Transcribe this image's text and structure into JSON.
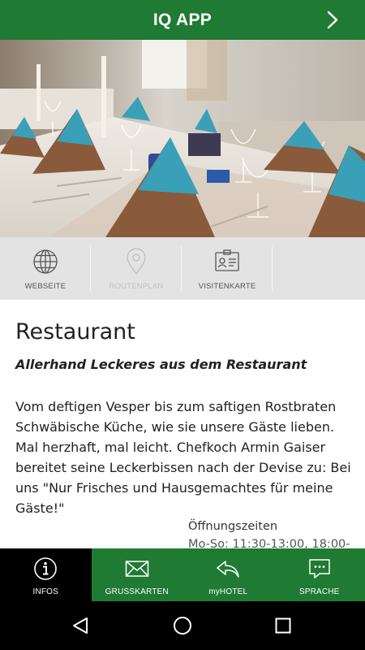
{
  "header": {
    "title": "IQ APP",
    "next_icon": "chevron-right-icon"
  },
  "actions": [
    {
      "label": "WEBSEITE",
      "icon": "globe-icon",
      "enabled": true
    },
    {
      "label": "ROUTENPLAN",
      "icon": "map-pin-icon",
      "enabled": false
    },
    {
      "label": "VISITENKARTE",
      "icon": "contact-card-icon",
      "enabled": true
    }
  ],
  "content": {
    "title": "Restaurant",
    "subtitle": "Allerhand Leckeres aus dem Restaurant",
    "body": "Vom deftigen Vesper bis zum saftigen Rostbraten Schwäbische Küche, wie sie unsere Gäste lieben. Mal herzhaft, mal leicht. Chefkoch Armin Gaiser bereitet seine Leckerbissen nach der Devise zu: Bei uns \"Nur Frisches und Hausgemachtes für meine Gäste!\"",
    "hours_title": "Öffnungszeiten",
    "hours_line": "Mo-So: 11:30-13:00, 18:00-"
  },
  "bottom_nav": [
    {
      "label": "INFOS",
      "icon": "info-icon",
      "active": true
    },
    {
      "label": "GRUSSKARTEN",
      "icon": "envelope-icon",
      "active": false
    },
    {
      "label": "myHOTEL",
      "icon": "reply-arrow-icon",
      "active": false
    },
    {
      "label": "SPRACHE",
      "icon": "chat-bubble-icon",
      "active": false
    }
  ],
  "colors": {
    "brand_green": "#1f7a33",
    "napkin_teal": "#3aa0b8",
    "napkin_brown": "#8a5a3c"
  }
}
